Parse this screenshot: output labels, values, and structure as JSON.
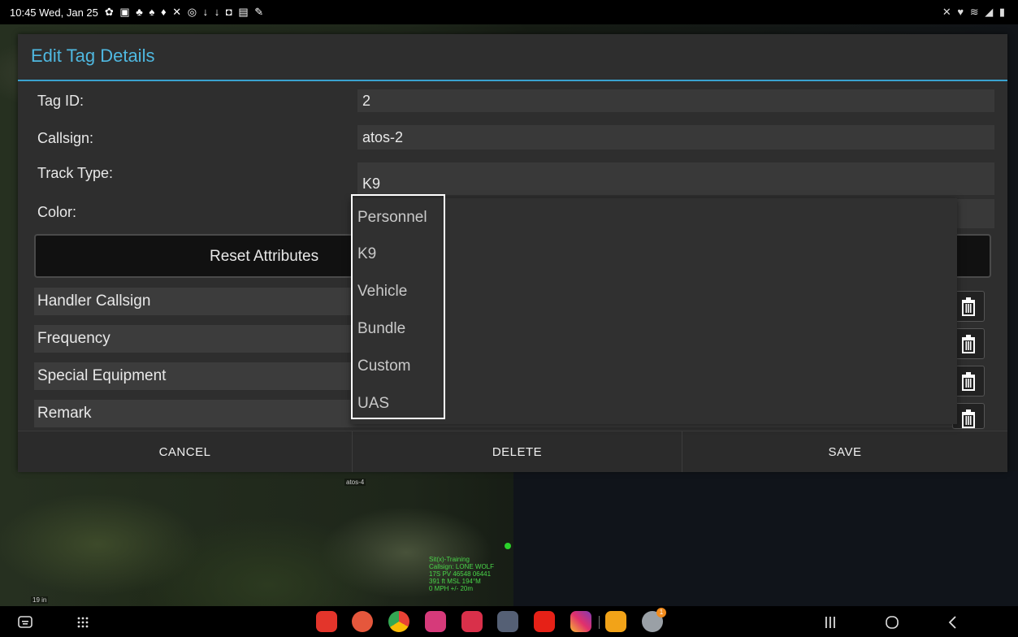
{
  "status_bar": {
    "time": "10:45  Wed, Jan 25",
    "notification_icons": "✿ ▣ ♣ ♠ ♦ ✕ ◎ ↓ ↓ ◘ ▤ ✎",
    "system_icons": "✕ ♥ ≋ ◢ ▮"
  },
  "dialog": {
    "title": "Edit Tag Details",
    "fields": {
      "tag_id": {
        "label": "Tag ID:",
        "value": "2"
      },
      "callsign": {
        "label": "Callsign:",
        "value": "atos-2"
      },
      "track_type": {
        "label": "Track Type:",
        "value": "K9"
      },
      "color": {
        "label": "Color:",
        "value": ""
      }
    },
    "reset_button": "Reset Attributes",
    "attributes": [
      {
        "label": "Handler Callsign"
      },
      {
        "label": "Frequency"
      },
      {
        "label": "Special Equipment"
      },
      {
        "label": "Remark"
      }
    ],
    "footer": {
      "cancel": "CANCEL",
      "delete": "DELETE",
      "save": "SAVE"
    }
  },
  "track_type_dropdown": {
    "options": [
      "Personnel",
      "K9",
      "Vehicle",
      "Bundle",
      "Custom",
      "UAS"
    ],
    "selected": "K9"
  },
  "map": {
    "marker_label": "atos-4",
    "scale_label": "19 in",
    "sitx_overlay": {
      "line1": "Sit(x)-Training",
      "line2": "Callsign: LONE WOLF",
      "line3": "17S  PV  46548  06441",
      "line4": "391 ft MSL      194°M",
      "line5": "0 MPH          +/- 20m"
    }
  },
  "nav_bar": {
    "apps": [
      "keyboard-icon",
      "apps-grid-icon",
      "red-app-icon",
      "person-app-icon",
      "chrome-icon",
      "flower-app-icon",
      "camera-app-icon",
      "chat-app-icon",
      "youtube-icon",
      "instagram-icon",
      "folder-icon",
      "atak-icon"
    ],
    "atak_badge": "1"
  },
  "colors": {
    "accent": "#4fb8e0",
    "dialog_bg": "#2e2e2e",
    "field_bg": "#393939"
  }
}
